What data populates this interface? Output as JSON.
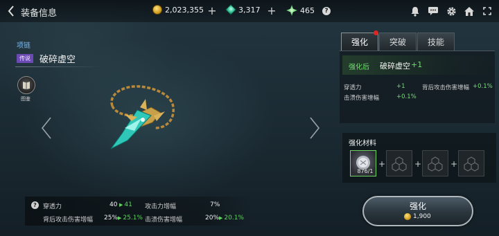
{
  "header": {
    "title": "装备信息",
    "gold": "2,023,355",
    "gems": "3,317",
    "crystals": "465",
    "help": "?"
  },
  "icons": {
    "back": "chevron-left-icon",
    "bell": "bell-icon",
    "chat": "chat-icon",
    "settings": "gear-icon",
    "home": "home-icon",
    "currency_gold": "gold-coin-icon",
    "currency_gem": "gem-icon",
    "currency_crystal": "crystal-icon",
    "codex": "book-icon"
  },
  "item": {
    "type": "项链",
    "grade": "传说",
    "name": "破碎虚空",
    "codex_label": "图鉴"
  },
  "stats": {
    "help": "?",
    "rows": [
      {
        "label": "穿透力",
        "value": "40",
        "up": "41"
      },
      {
        "label": "攻击力增幅",
        "value": "7%",
        "up": ""
      },
      {
        "label": "背后攻击伤害增幅",
        "value": "25%",
        "up": "25.1%"
      },
      {
        "label": "击溃伤害增幅",
        "value": "20%",
        "up": "20.1%"
      }
    ]
  },
  "tabs": [
    {
      "label": "强化",
      "active": true
    },
    {
      "label": "突破",
      "active": false
    },
    {
      "label": "技能",
      "active": false
    }
  ],
  "upgrade": {
    "after_label": "强化后",
    "after_name": "破碎虚空",
    "after_plus": "+1",
    "rows": [
      {
        "label": "穿透力",
        "value": "+1"
      },
      {
        "label": "背后攻击伤害增幅",
        "value": "+0.1%"
      },
      {
        "label": "击溃伤害增幅",
        "value": "+0.1%"
      }
    ]
  },
  "materials": {
    "title": "强化材料",
    "first_count": "876/1",
    "plus": "+"
  },
  "enhance_button": {
    "label": "强化",
    "cost": "1,900"
  },
  "colors": {
    "accent_green": "#6fe06f",
    "grade_purple": "#6b4bb3",
    "type_blue": "#7fb9e8",
    "notify_red": "#e02525"
  }
}
